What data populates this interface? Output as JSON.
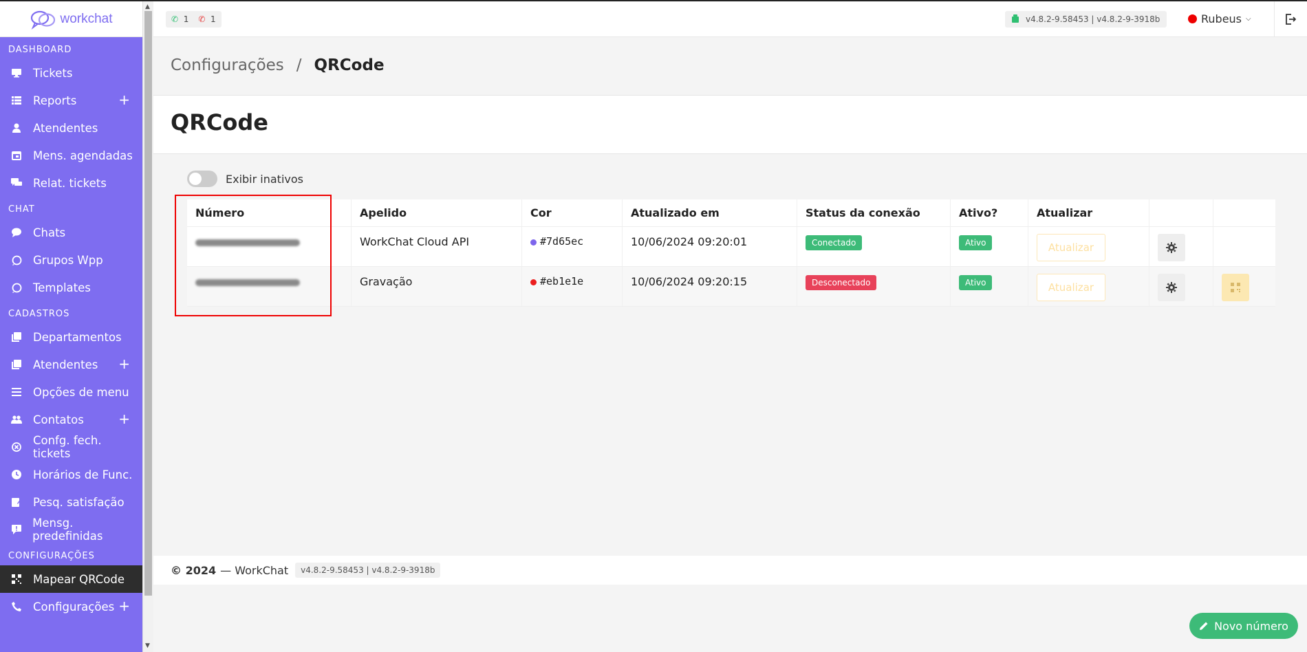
{
  "brand": {
    "name": "workchat"
  },
  "topbar": {
    "calls_incoming": "1",
    "calls_missed": "1",
    "version": "v4.8.2-9.58453 | v4.8.2-9-3918b",
    "user_name": "Rubeus"
  },
  "sidebar": {
    "sections": {
      "dashboard": "DASHBOARD",
      "chat": "CHAT",
      "cadastros": "CADASTROS",
      "configuracoes": "CONFIGURAÇÕES"
    },
    "items": {
      "tickets": "Tickets",
      "reports": "Reports",
      "atendentes_dash": "Atendentes",
      "mens_agendadas": "Mens. agendadas",
      "relat_tickets": "Relat. tickets",
      "chats": "Chats",
      "grupos_wpp": "Grupos Wpp",
      "templates": "Templates",
      "departamentos": "Departamentos",
      "atendentes_cad": "Atendentes",
      "opcoes_menu": "Opções de menu",
      "contatos": "Contatos",
      "confg_fech_tickets": "Confg. fech. tickets",
      "horarios_func": "Horários de Func.",
      "pesq_satisfacao": "Pesq. satisfação",
      "mensg_predefinidas": "Mensg. predefinidas",
      "mapear_qrcode": "Mapear QRCode",
      "configuracoes": "Configurações"
    }
  },
  "breadcrumb": {
    "parent": "Configurações",
    "separator": "/",
    "current": "QRCode"
  },
  "page_title": "QRCode",
  "toggle": {
    "label": "Exibir inativos",
    "on": false
  },
  "table": {
    "headers": [
      "Número",
      "Apelido",
      "Cor",
      "Atualizado em",
      "Status da conexão",
      "Ativo?",
      "Atualizar"
    ],
    "rows": [
      {
        "apelido": "WorkChat Cloud API",
        "cor": "#7d65ec",
        "cor_hex": "#7d65ec",
        "atualizado": "10/06/2024 09:20:01",
        "status": "Conectado",
        "ativo": "Ativo",
        "btn": "Atualizar"
      },
      {
        "apelido": "Gravação",
        "cor": "#eb1e1e",
        "cor_hex": "#eb1e1e",
        "atualizado": "10/06/2024 09:20:15",
        "status": "Desconectado",
        "ativo": "Ativo",
        "btn": "Atualizar"
      }
    ]
  },
  "footer": {
    "year": "© 2024",
    "text": "— WorkChat",
    "version": "v4.8.2-9.58453 | v4.8.2-9-3918b"
  },
  "new_button": "Novo número"
}
